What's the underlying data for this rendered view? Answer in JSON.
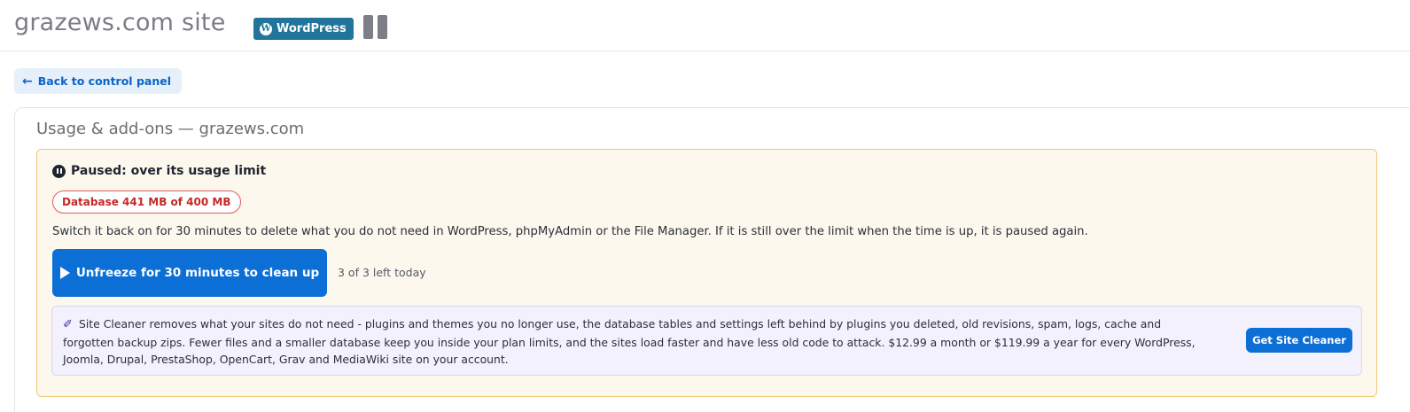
{
  "header": {
    "site_title": "grazews.com site",
    "platform_badge": "WordPress",
    "platform_logo_letter": "W",
    "status_icon": "pause-icon"
  },
  "nav": {
    "back_label": "Back to control panel",
    "back_icon": "arrow-left-icon"
  },
  "card": {
    "title": "Usage & add-ons — grazews.com",
    "warning": {
      "status_label": "Paused: over its usage limit",
      "status_icon": "pause-circle-icon",
      "usage_badge": "Database 441 MB of 400 MB",
      "description": "Switch it back on for 30 minutes to delete what you do not need in WordPress, phpMyAdmin or the File Manager. If it is still over the limit when the time is up, it is paused again.",
      "unfreeze_label": "Unfreeze for 30 minutes to clean up",
      "unfreeze_icon": "play-icon",
      "remaining": "3 of 3 left today"
    },
    "cleaner": {
      "icon": "broom-icon",
      "text": "Site Cleaner removes what your sites do not need - plugins and themes you no longer use, the database tables and settings left behind by plugins you deleted, old revisions, spam, logs, cache and forgotten backup zips. Fewer files and a smaller database keep you inside your plan limits, and the sites load faster and have less old code to attack. $12.99 a month or $119.99 a year for every WordPress, Joomla, Drupal, PrestaShop, OpenCart, Grav and MediaWiki site on your account.",
      "button_label": "Get Site Cleaner"
    }
  },
  "colors": {
    "accent": "#0b6fd6",
    "wordpress": "#21759b",
    "warning_bg": "#fdf8ed",
    "warning_border": "#f0c878",
    "danger": "#c62828",
    "cleaner_bg": "#f3f1fd"
  }
}
